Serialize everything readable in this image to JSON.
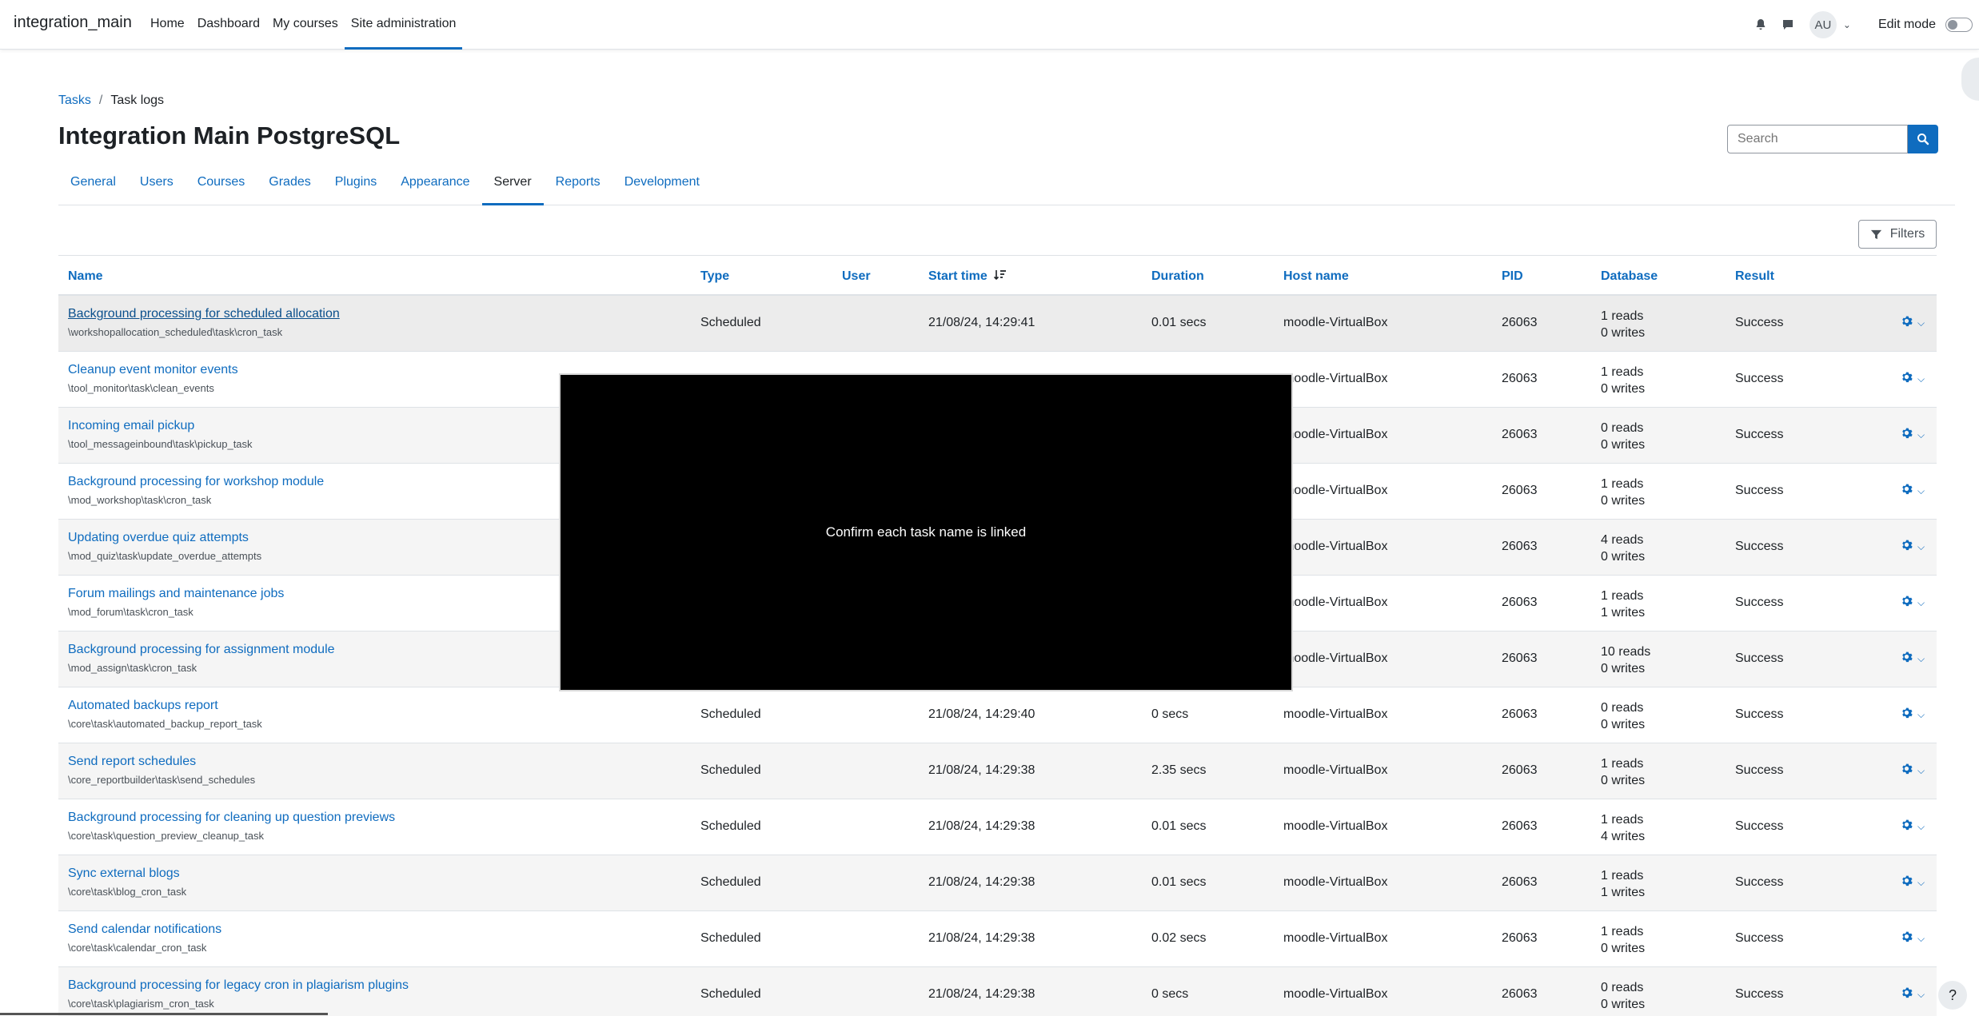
{
  "navbar": {
    "brand": "integration_main",
    "items": [
      {
        "label": "Home"
      },
      {
        "label": "Dashboard"
      },
      {
        "label": "My courses"
      },
      {
        "label": "Site administration"
      }
    ],
    "avatar_initials": "AU",
    "edit_mode_label": "Edit mode"
  },
  "breadcrumb": {
    "parent": "Tasks",
    "separator": "/",
    "current": "Task logs"
  },
  "page_title": "Integration Main PostgreSQL",
  "search": {
    "placeholder": "Search"
  },
  "admin_tabs": [
    {
      "label": "General"
    },
    {
      "label": "Users"
    },
    {
      "label": "Courses"
    },
    {
      "label": "Grades"
    },
    {
      "label": "Plugins"
    },
    {
      "label": "Appearance"
    },
    {
      "label": "Server"
    },
    {
      "label": "Reports"
    },
    {
      "label": "Development"
    }
  ],
  "filters_label": "Filters",
  "table": {
    "columns": {
      "name": "Name",
      "type": "Type",
      "user": "User",
      "start_time": "Start time",
      "duration": "Duration",
      "host": "Host name",
      "pid": "PID",
      "database": "Database",
      "result": "Result"
    },
    "rows": [
      {
        "name": "Background processing for scheduled allocation",
        "classname": "\\workshopallocation_scheduled\\task\\cron_task",
        "type": "Scheduled",
        "start": "21/08/24, 14:29:41",
        "duration": "0.01 secs",
        "host": "moodle-VirtualBox",
        "pid": "26063",
        "reads": "1 reads",
        "writes": "0 writes",
        "result": "Success"
      },
      {
        "name": "Cleanup event monitor events",
        "classname": "\\tool_monitor\\task\\clean_events",
        "type": "",
        "start": "",
        "duration": "",
        "host": "moodle-VirtualBox",
        "pid": "26063",
        "reads": "1 reads",
        "writes": "0 writes",
        "result": "Success"
      },
      {
        "name": "Incoming email pickup",
        "classname": "\\tool_messageinbound\\task\\pickup_task",
        "type": "",
        "start": "",
        "duration": "",
        "host": "moodle-VirtualBox",
        "pid": "26063",
        "reads": "0 reads",
        "writes": "0 writes",
        "result": "Success"
      },
      {
        "name": "Background processing for workshop module",
        "classname": "\\mod_workshop\\task\\cron_task",
        "type": "",
        "start": "",
        "duration": "",
        "host": "moodle-VirtualBox",
        "pid": "26063",
        "reads": "1 reads",
        "writes": "0 writes",
        "result": "Success"
      },
      {
        "name": "Updating overdue quiz attempts",
        "classname": "\\mod_quiz\\task\\update_overdue_attempts",
        "type": "",
        "start": "",
        "duration": "",
        "host": "moodle-VirtualBox",
        "pid": "26063",
        "reads": "4 reads",
        "writes": "0 writes",
        "result": "Success"
      },
      {
        "name": "Forum mailings and maintenance jobs",
        "classname": "\\mod_forum\\task\\cron_task",
        "type": "",
        "start": "",
        "duration": "",
        "host": "moodle-VirtualBox",
        "pid": "26063",
        "reads": "1 reads",
        "writes": "1 writes",
        "result": "Success"
      },
      {
        "name": "Background processing for assignment module",
        "classname": "\\mod_assign\\task\\cron_task",
        "type": "",
        "start": "",
        "duration": "",
        "host": "moodle-VirtualBox",
        "pid": "26063",
        "reads": "10 reads",
        "writes": "0 writes",
        "result": "Success"
      },
      {
        "name": "Automated backups report",
        "classname": "\\core\\task\\automated_backup_report_task",
        "type": "Scheduled",
        "start": "21/08/24, 14:29:40",
        "duration": "0 secs",
        "host": "moodle-VirtualBox",
        "pid": "26063",
        "reads": "0 reads",
        "writes": "0 writes",
        "result": "Success"
      },
      {
        "name": "Send report schedules",
        "classname": "\\core_reportbuilder\\task\\send_schedules",
        "type": "Scheduled",
        "start": "21/08/24, 14:29:38",
        "duration": "2.35 secs",
        "host": "moodle-VirtualBox",
        "pid": "26063",
        "reads": "1 reads",
        "writes": "0 writes",
        "result": "Success"
      },
      {
        "name": "Background processing for cleaning up question previews",
        "classname": "\\core\\task\\question_preview_cleanup_task",
        "type": "Scheduled",
        "start": "21/08/24, 14:29:38",
        "duration": "0.01 secs",
        "host": "moodle-VirtualBox",
        "pid": "26063",
        "reads": "1 reads",
        "writes": "4 writes",
        "result": "Success"
      },
      {
        "name": "Sync external blogs",
        "classname": "\\core\\task\\blog_cron_task",
        "type": "Scheduled",
        "start": "21/08/24, 14:29:38",
        "duration": "0.01 secs",
        "host": "moodle-VirtualBox",
        "pid": "26063",
        "reads": "1 reads",
        "writes": "1 writes",
        "result": "Success"
      },
      {
        "name": "Send calendar notifications",
        "classname": "\\core\\task\\calendar_cron_task",
        "type": "Scheduled",
        "start": "21/08/24, 14:29:38",
        "duration": "0.02 secs",
        "host": "moodle-VirtualBox",
        "pid": "26063",
        "reads": "1 reads",
        "writes": "0 writes",
        "result": "Success"
      },
      {
        "name": "Background processing for legacy cron in plagiarism plugins",
        "classname": "\\core\\task\\plagiarism_cron_task",
        "type": "Scheduled",
        "start": "21/08/24, 14:29:38",
        "duration": "0 secs",
        "host": "moodle-VirtualBox",
        "pid": "26063",
        "reads": "0 reads",
        "writes": "0 writes",
        "result": "Success"
      }
    ]
  },
  "overlay_text": "Confirm each task name is linked",
  "help_label": "?",
  "icons": {
    "notifications": "bell-icon",
    "messages": "chat-icon",
    "search": "search-icon",
    "filter": "filter-icon",
    "actions": "gear-icon",
    "sort": "sort-descending-icon"
  },
  "colors": {
    "link": "#0f6cbf",
    "primary": "#0f6cbf",
    "stripe": "#f5f5f5"
  }
}
